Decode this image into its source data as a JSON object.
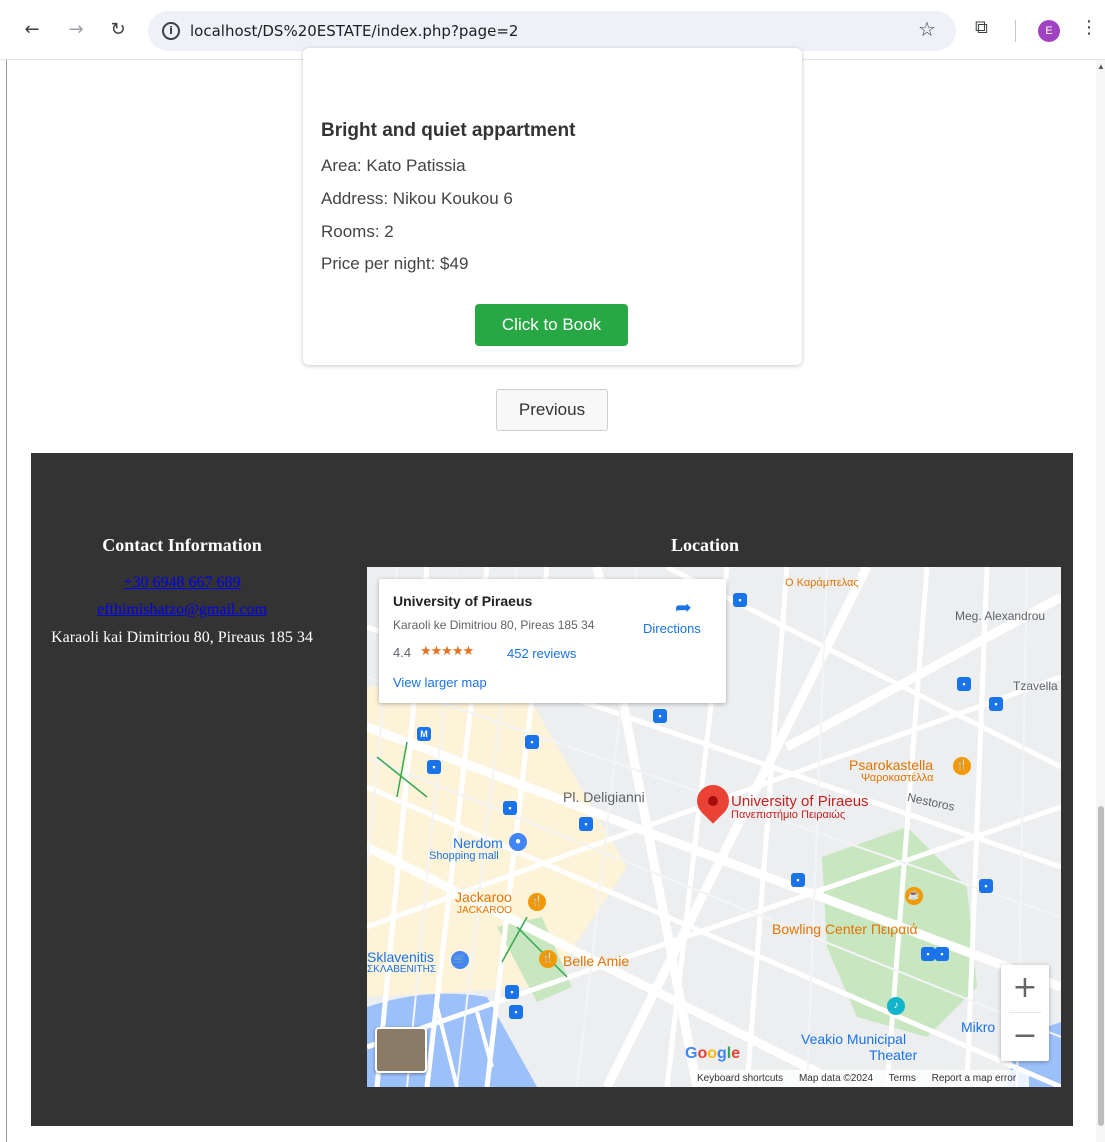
{
  "browser": {
    "url": "localhost/DS%20ESTATE/index.php?page=2",
    "avatar_letter": "E"
  },
  "listing": {
    "title": "Bright and quiet appartment",
    "area": "Area: Kato Patissia",
    "address": "Address: Nikou Koukou 6",
    "rooms": "Rooms: 2",
    "price": "Price per night: $49",
    "book_label": "Click to Book"
  },
  "pagination": {
    "previous_label": "Previous"
  },
  "footer": {
    "contact_title": "Contact Information",
    "phone": "+30 6948 667 689",
    "email": "efthimishatzo@gmail.com",
    "address": "Karaoli kai Dimitriou 80, Pireaus 185 34",
    "location_title": "Location"
  },
  "map": {
    "place_name": "University of Piraeus",
    "place_address": "Karaoli ke Dimitriou 80, Pireas 185 34",
    "rating": "4.4",
    "stars": "★★★★★",
    "reviews": "452 reviews",
    "directions": "Directions",
    "view_larger": "View larger map",
    "pin_label": "University of Piraeus",
    "pin_label_greek": "Πανεπιστήμιο Πειραιώς",
    "google": "Google",
    "attribution": {
      "shortcuts": "Keyboard shortcuts",
      "data": "Map data ©2024",
      "terms": "Terms",
      "report": "Report a map error"
    },
    "labels": {
      "deligianni": "Pl. Deligianni",
      "nerdom": "Nerdom",
      "shopping_mall": "Shopping mall",
      "jackaroo": "Jackaroo",
      "jackaroo_caps": "JACKAROO",
      "sklavenitis": "Sklavenitis",
      "sklavenitis_greek": "ΣΚΛΑΒΕΝΙΤΗΣ",
      "belle_amie": "Belle Amie",
      "psarokastella": "Psarokastella",
      "psarokastella_greek": "Ψαροκαστέλλα",
      "bowling": "Bowling Center Πειραιά",
      "veakio": "Veakio Municipal",
      "theater": "Theater",
      "meg_alexandrou": "Meg. Alexandrou",
      "tzavella": "Tzavella",
      "nestoros": "Nestoros",
      "o_karampelas": "Ο Καράμπελας",
      "mikro": "Mikro"
    },
    "zoom_in": "+",
    "zoom_out": "−",
    "colors": {
      "water": "#9cc0f9",
      "park": "#c8e6c0",
      "road": "#ffffff",
      "block": "#eceef0",
      "poi_orange": "#f29900",
      "poi_blue": "#4285f4",
      "pin_red": "#ea4335",
      "pin_text": "#c5221f"
    }
  }
}
